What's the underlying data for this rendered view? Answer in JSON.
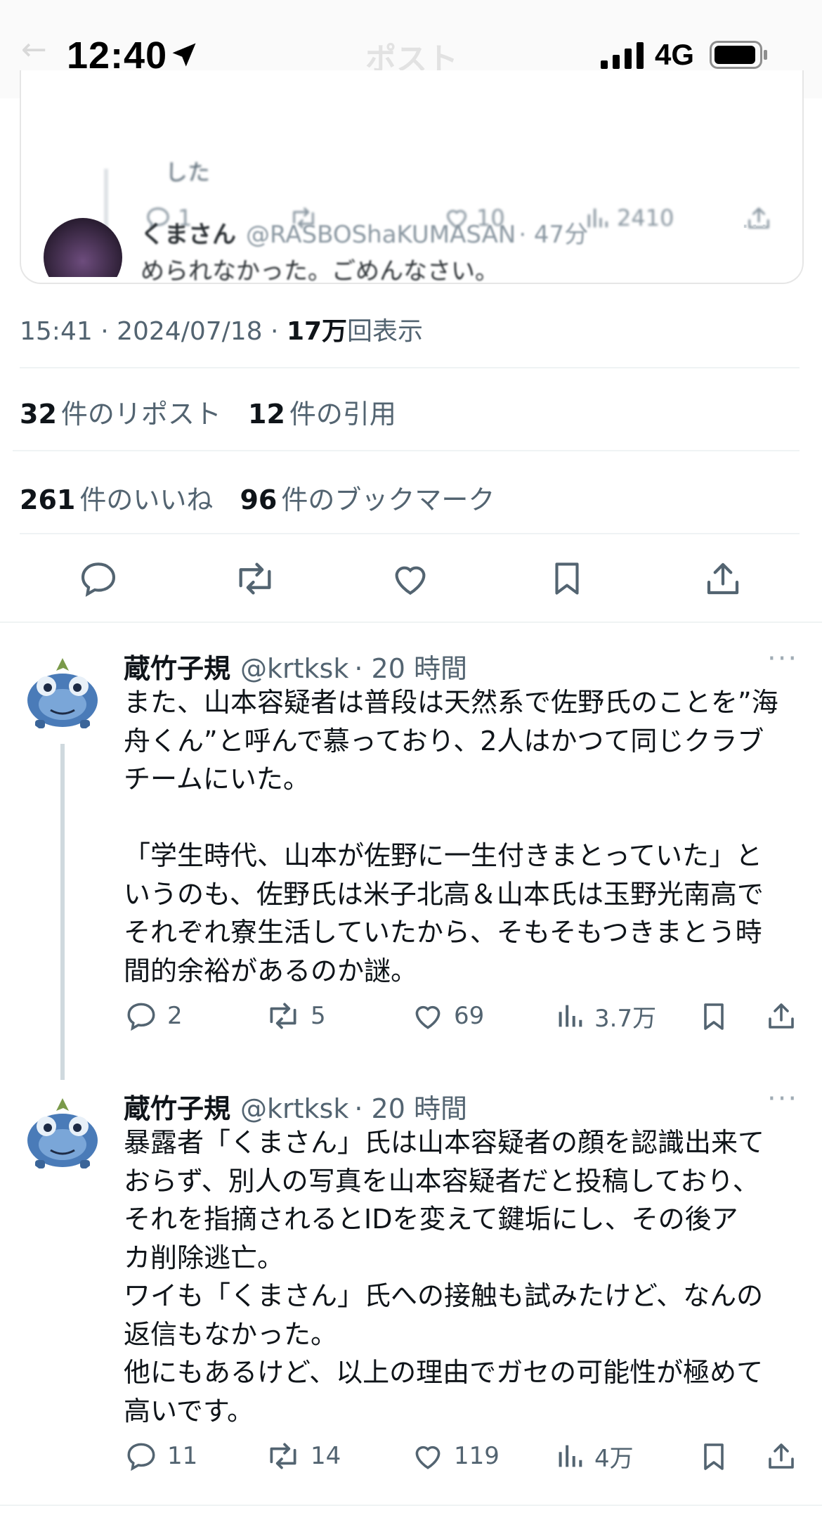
{
  "status_bar": {
    "time": "12:40",
    "network": "4G",
    "faded_title": "ポスト",
    "faded_back": "←"
  },
  "embedded_reply": {
    "stub_text": "した",
    "actions": {
      "reply": "1",
      "likes": "10",
      "views": "2410"
    },
    "author_name": "くまさん",
    "author_handle": "@RASBOShaKUMASAN",
    "time": "· 47分",
    "text": "められなかった。ごめんなさい。"
  },
  "post_meta": {
    "time": "15:41",
    "date": "2024/07/18",
    "views_count": "17万",
    "views_label": "回表示"
  },
  "stats": {
    "reposts_count": "32",
    "reposts_label": "件のリポスト",
    "quotes_count": "12",
    "quotes_label": "件の引用",
    "likes_count": "261",
    "likes_label": "件のいいね",
    "bookmarks_count": "96",
    "bookmarks_label": "件のブックマーク"
  },
  "tweets": [
    {
      "name": "蔵竹子規",
      "handle": "@krtksk",
      "time": "· 20 時間",
      "lines": [
        "また、山本容疑者は普段は天然系で佐野氏のことを”海",
        "舟くん”と呼んで慕っており、2人はかつて同じクラブ",
        "チームにいた。",
        "",
        "「学生時代、山本が佐野に一生付きまとっていた」と",
        "いうのも、佐野氏は米子北高＆山本氏は玉野光南高で",
        "それぞれ寮生活していたから、そもそもつきまとう時",
        "間的余裕があるのか謎。"
      ],
      "replies": "2",
      "reposts": "5",
      "likes": "69",
      "views": "3.7万"
    },
    {
      "name": "蔵竹子規",
      "handle": "@krtksk",
      "time": "· 20 時間",
      "lines": [
        "暴露者「くまさん」氏は山本容疑者の顔を認識出来て",
        "おらず、別人の写真を山本容疑者だと投稿しており、",
        "それを指摘されるとIDを変えて鍵垢にし、その後ア",
        "カ削除逃亡。",
        "ワイも「くまさん」氏への接触も試みたけど、なんの",
        "返信もなかった。",
        "他にもあるけど、以上の理由でガセの可能性が極めて",
        "高いです。"
      ],
      "replies": "11",
      "reposts": "14",
      "likes": "119",
      "views": "4万"
    }
  ]
}
